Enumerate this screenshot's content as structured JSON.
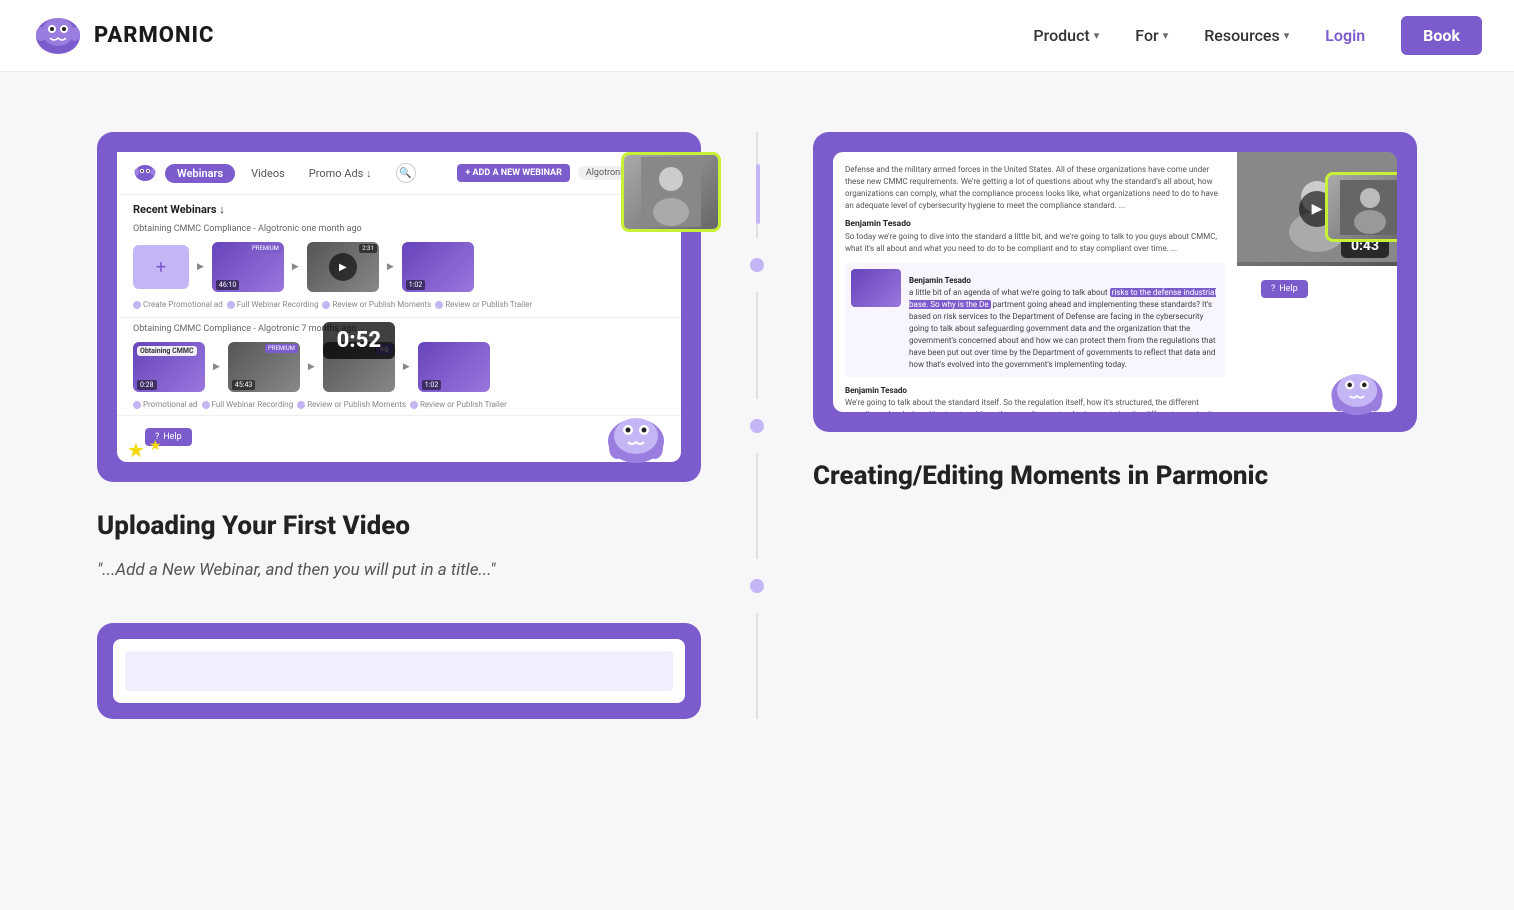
{
  "nav": {
    "brand_name": "PARMONIC",
    "links": [
      {
        "label": "Product",
        "has_chevron": true
      },
      {
        "label": "For",
        "has_chevron": true
      },
      {
        "label": "Resources",
        "has_chevron": true
      }
    ],
    "login_label": "Login",
    "book_label": "Book"
  },
  "left_article": {
    "card_timer": "0:52",
    "title": "Uploading Your First Video",
    "quote": "\"...Add a New Webinar, and then you will put in a title...\""
  },
  "left_mockup": {
    "tabs": [
      "Webinars",
      "Videos",
      "Promo Ads ↓"
    ],
    "add_button": "+ ADD A NEW WEBINAR",
    "section_title": "Recent Webinars ↓",
    "row1_title": "Obtaining CMMC Compliance - Algotronic  one month ago",
    "row2_title": "Obtaining CMMC Compliance - Algotronic  7 months ago",
    "times": [
      "46:10",
      "2:31",
      "1:02",
      "0:28",
      "45:43",
      "2:31",
      "1:02"
    ]
  },
  "right_article": {
    "card_timer": "0:43",
    "title": "Creating/Editing Moments in Parmonic"
  },
  "transcript": {
    "speaker1": "Benjamin Tesado",
    "text1": "a little bit of an agenda of what we're going to talk about risks to the defense industrial base. So why is the Department going ahead and implementing these standards? It's based on risk services to the Department of Defense are facing in the cyber security going to talk about safeguarding government data and the organization that the government's concerned about and how we can protect them from the regulations that have been put out over time by the Department of governments to reflect that data and how that's evolved into the government's implementing today.",
    "speaker2": "Benjamin Tesado",
    "text2": "We're going to talk about the standard itself. So the regulation itself, how it's structured, the different compliance levels, how it's structured, how the compliance standard came to be, the different organizations that participated in putting the standard together. And then we're going to talk about the CMMC governing body, or the organization that oversees the implementation of the Cybersecurity Maturity Model Certification standard. We're going to talk about security and industry challenges with compliance to the standard. This is an interesting topic that a lot of our customers and"
  },
  "decorations": {
    "star1": "★",
    "star2": "★",
    "play_icon": "▶"
  }
}
